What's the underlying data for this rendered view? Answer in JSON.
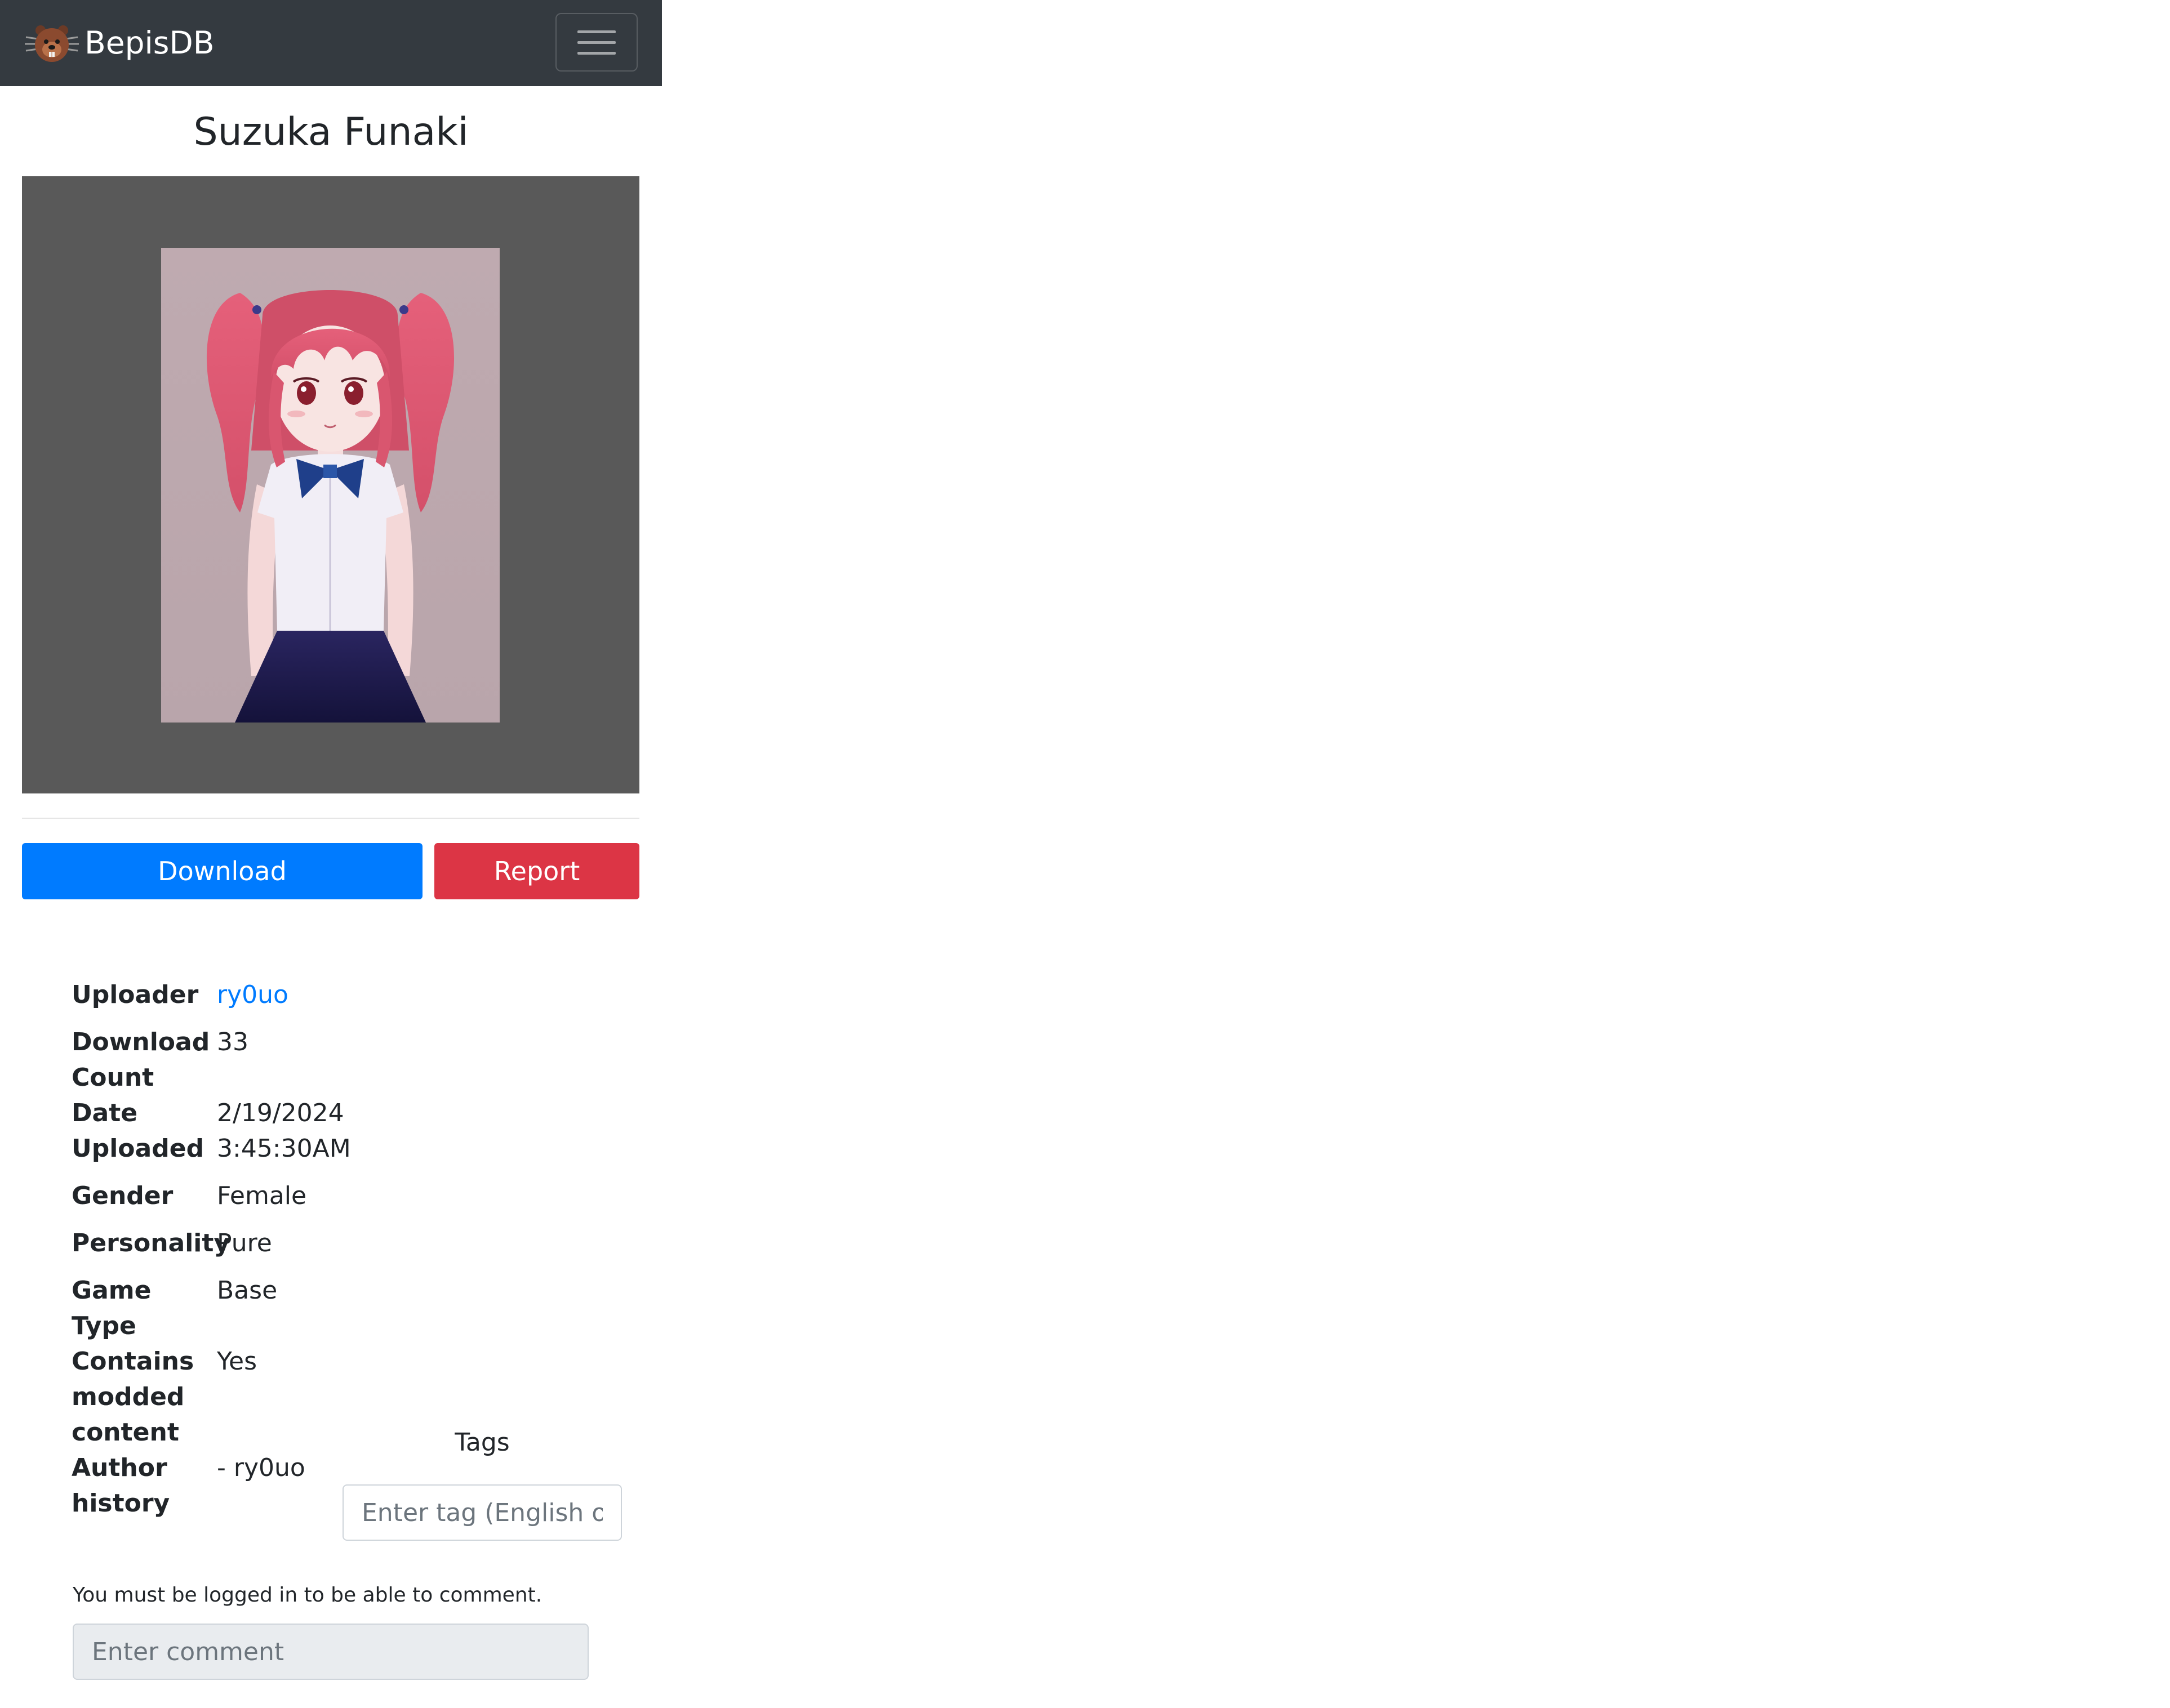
{
  "navbar": {
    "brand": "BepisDB",
    "logo_icon": "bepis-beaver-logo-icon",
    "menu_icon": "hamburger-menu-icon"
  },
  "card": {
    "title": "Suzuka Funaki",
    "image_alt": "Character card preview"
  },
  "actions": {
    "download_label": "Download",
    "report_label": "Report",
    "download_color": "#007bff",
    "report_color": "#dc3545"
  },
  "info": {
    "uploader_label": "Uploader",
    "uploader_value": "ry0uo",
    "download_count_label_1": "Download",
    "download_count_label_2": "Count",
    "download_count_value": "33",
    "date_label_1": "Date",
    "date_label_2": "Uploaded",
    "date_value_1": "2/19/2024",
    "date_value_2": "3:45:30AM",
    "gender_label": "Gender",
    "gender_value": "Female",
    "personality_label": "Personality",
    "personality_value": "Pure",
    "game_type_label_1": "Game",
    "game_type_label_2": "Type",
    "game_type_value": "Base",
    "modded_label_1": "Contains",
    "modded_label_2": "modded",
    "modded_label_3": "content",
    "modded_value": "Yes",
    "author_history_label_1": "Author",
    "author_history_label_2": "history",
    "author_history_value": "- ry0uo"
  },
  "tags": {
    "label": "Tags",
    "placeholder": "Enter tag (English only)"
  },
  "comments": {
    "login_note": "You must be logged in to be able to comment.",
    "placeholder": "Enter comment"
  }
}
